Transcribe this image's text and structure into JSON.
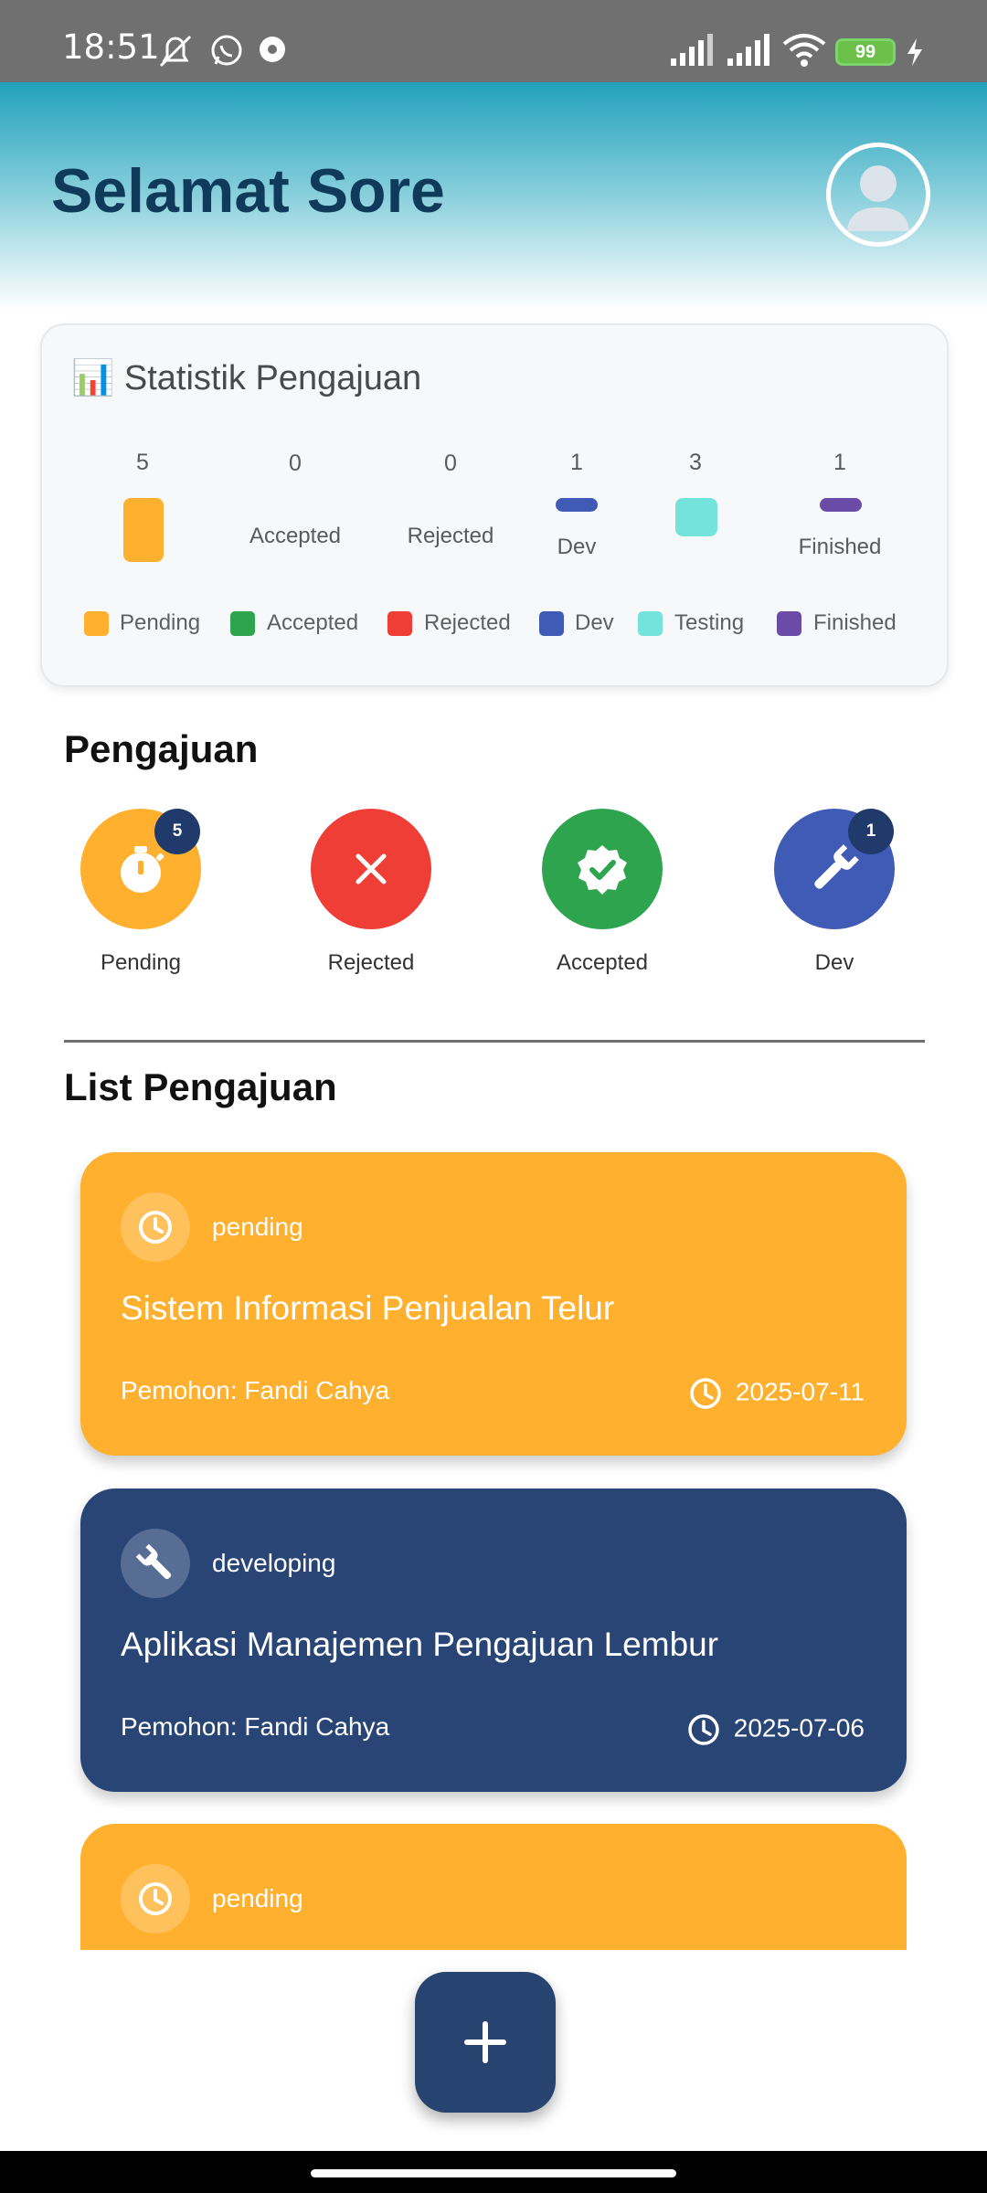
{
  "status_bar": {
    "time": "18:51",
    "battery": "99",
    "icons": [
      "mute-icon",
      "whatsapp-icon",
      "record-icon",
      "signal-icon",
      "signal-icon",
      "wifi-icon",
      "battery-icon",
      "charging-icon"
    ]
  },
  "header": {
    "greeting": "Selamat Sore",
    "avatar_icon": "user-avatar-icon"
  },
  "stats": {
    "title": "📊 Statistik Pengajuan",
    "columns": [
      {
        "count": "5",
        "label": "",
        "color": "#ffb02e"
      },
      {
        "count": "0",
        "label": "Accepted",
        "color": "#2ea44f"
      },
      {
        "count": "0",
        "label": "Rejected",
        "color": "#ef3e36"
      },
      {
        "count": "1",
        "label": "Dev",
        "color": "#3f5bb5"
      },
      {
        "count": "3",
        "label": "",
        "color": "#74e3dc"
      },
      {
        "count": "1",
        "label": "Finished",
        "color": "#6a4ca8"
      }
    ],
    "legend": [
      {
        "label": "Pending",
        "color": "#ffb02e"
      },
      {
        "label": "Accepted",
        "color": "#2ea44f"
      },
      {
        "label": "Rejected",
        "color": "#ef3e36"
      },
      {
        "label": "Dev",
        "color": "#3f5bb5"
      },
      {
        "label": "Testing",
        "color": "#74e3dc"
      },
      {
        "label": "Finished",
        "color": "#6a4ca8"
      }
    ]
  },
  "pengajuan": {
    "title": "Pengajuan",
    "categories": [
      {
        "label": "Pending",
        "badge": "5",
        "icon": "stopwatch-icon",
        "color": "#ffb02e"
      },
      {
        "label": "Rejected",
        "badge": "",
        "icon": "close-icon",
        "color": "#ef3e36"
      },
      {
        "label": "Accepted",
        "badge": "",
        "icon": "verified-icon",
        "color": "#2ea44f"
      },
      {
        "label": "Dev",
        "badge": "1",
        "icon": "wrench-icon",
        "color": "#3f5bb5"
      }
    ]
  },
  "list": {
    "title": "List Pengajuan",
    "items": [
      {
        "status": "pending",
        "title": "Sistem Informasi Penjualan Telur",
        "applicant": "Pemohon: Fandi Cahya",
        "date": "2025-07-11",
        "color": "#ffb02e",
        "icon": "clock-icon"
      },
      {
        "status": "developing",
        "title": "Aplikasi Manajemen Pengajuan Lembur",
        "applicant": "Pemohon: Fandi Cahya",
        "date": "2025-07-06",
        "color": "#284575",
        "icon": "wrench-icon"
      },
      {
        "status": "pending",
        "title": "",
        "applicant": "",
        "date": "",
        "color": "#ffb02e",
        "icon": "clock-icon"
      }
    ]
  },
  "fab": {
    "icon": "plus-icon"
  }
}
